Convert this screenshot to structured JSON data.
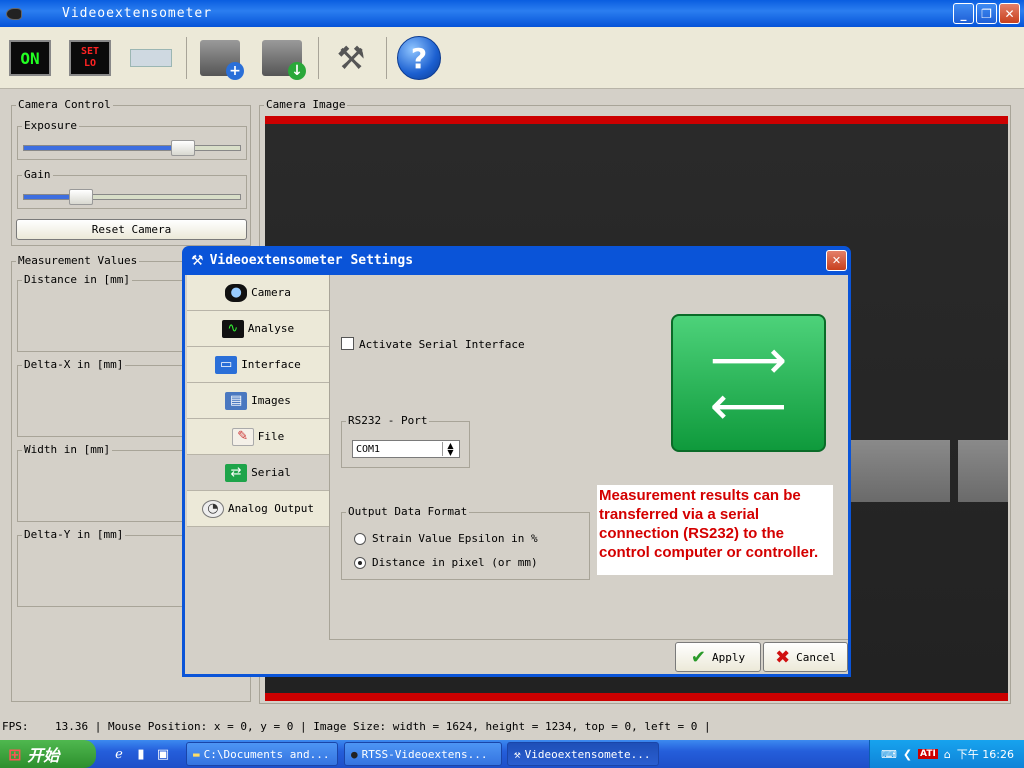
{
  "window": {
    "title": "Videoextensometer"
  },
  "toolbar": {
    "on_label": "ON",
    "set_label_1": "SET",
    "set_label_2": "LO"
  },
  "camera_control": {
    "title": "Camera Control",
    "exposure_label": "Exposure",
    "exposure_level": 0.73,
    "gain_label": "Gain",
    "gain_level": 0.26,
    "reset_label": "Reset Camera"
  },
  "measurement": {
    "title": "Measurement Values",
    "fields": [
      "Distance in [mm]",
      "Delta-X in [mm]",
      "Width in [mm]",
      "Delta-Y in [mm]"
    ]
  },
  "camera_image": {
    "title": "Camera Image"
  },
  "dialog": {
    "title": "Videoextensometer Settings",
    "nav": [
      "Camera",
      "Analyse",
      "Interface",
      "Images",
      "File",
      "Serial",
      "Analog Output"
    ],
    "activate_label": "Activate Serial Interface",
    "rs232_title": "RS232 - Port",
    "port_value": "COM1",
    "format_title": "Output Data Format",
    "format_options": [
      "Strain Value Epsilon in %",
      "Distance in pixel (or mm)"
    ],
    "selected_format": 1,
    "note": "Measurement results can be transferred via a serial connection (RS232) to the control computer or controller.",
    "apply_label": "Apply",
    "cancel_label": "Cancel"
  },
  "status": {
    "text": "FPS:    13.36 | Mouse Position: x = 0, y = 0 | Image Size: width = 1624, height = 1234, top = 0, left = 0 |"
  },
  "taskbar": {
    "start_label": "开始",
    "tasks": [
      "C:\\Documents and...",
      "RTSS-Videoextens...",
      "Videoextensomete..."
    ],
    "clock": "下午 16:26"
  }
}
